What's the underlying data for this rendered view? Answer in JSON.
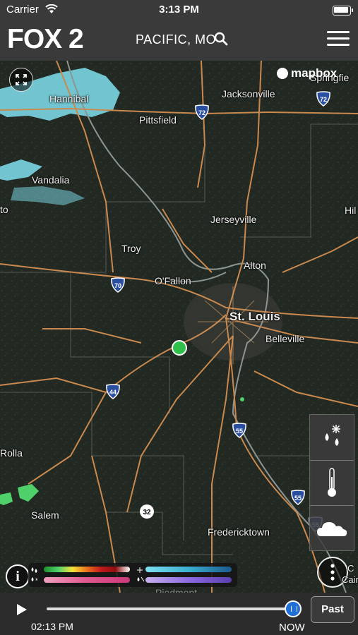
{
  "status_bar": {
    "carrier": "Carrier",
    "time": "3:13 PM"
  },
  "header": {
    "logo": "FOX 2",
    "location": "PACIFIC, MO"
  },
  "map": {
    "attribution": "mapbox",
    "cities": {
      "hannibal": "Hannibal",
      "jacksonville": "Jacksonville",
      "springfield": "Springfie",
      "pittsfield": "Pittsfield",
      "vandalia": "Vandalia",
      "jerseyville": "Jerseyville",
      "troy": "Troy",
      "ofallon": "O'Fallon",
      "alton": "Alton",
      "stlouis": "St. Louis",
      "belleville": "Belleville",
      "rolla": "Rolla",
      "salem": "Salem",
      "fredericktown": "Fredericktown",
      "hil": "Hil",
      "to": "to",
      "piedmont": "Piedmont",
      "cairo": "C\nCaira"
    },
    "shields": {
      "i72a": "72",
      "i72b": "72",
      "i70": "70",
      "i44": "44",
      "i55a": "55",
      "i55b": "55",
      "i55c": "55",
      "rt32": "32"
    },
    "colors": {
      "radar_snow": "#7fe0ef",
      "radar_rain": "#4fd06a",
      "location_dot": "#2fbf4a",
      "road": "#c9894f"
    }
  },
  "layers": {
    "icons": [
      "snow-rain-icon",
      "thermometer-icon",
      "cloud-icon"
    ]
  },
  "timeline": {
    "start_time": "02:13 PM",
    "end_label": "NOW",
    "past_label": "Past",
    "progress": 1.0
  }
}
